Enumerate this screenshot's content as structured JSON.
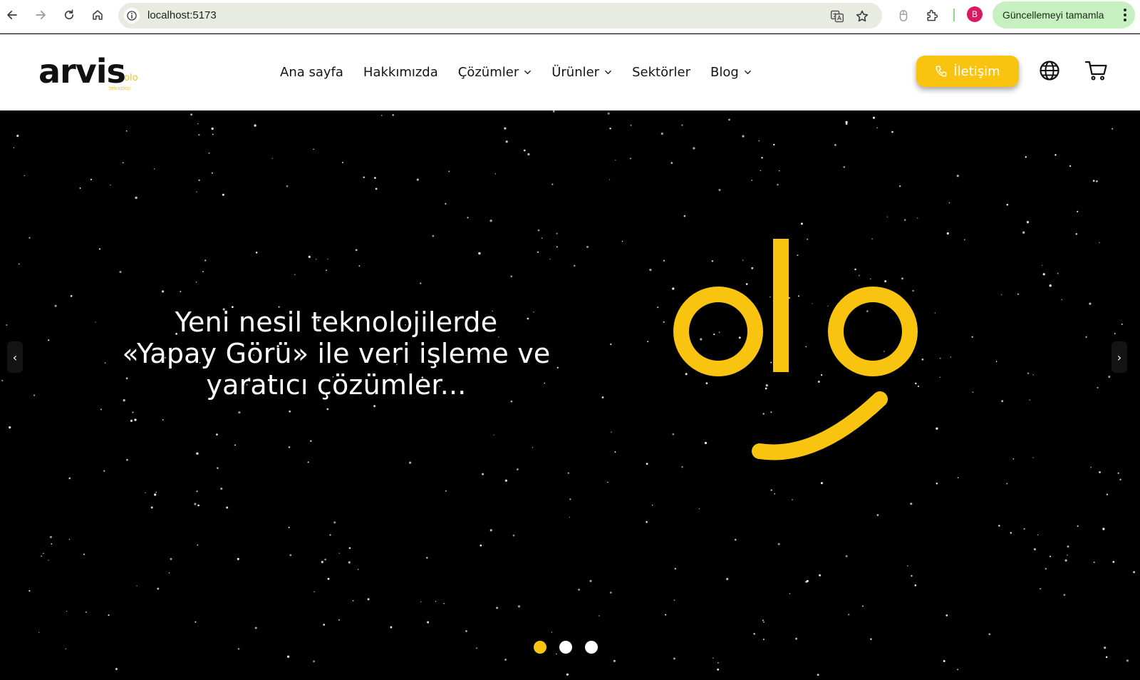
{
  "browser": {
    "url": "localhost:5173",
    "profile_initial": "B",
    "update_label": "Güncellemeyi tamamla",
    "accent_update_bg": "#c6f0bf"
  },
  "header": {
    "logo_text": "arvis",
    "logo_sub": "olo",
    "logo_tagline": "teknoloji",
    "nav": [
      {
        "label": "Ana sayfa",
        "dropdown": false
      },
      {
        "label": "Hakkımızda",
        "dropdown": false
      },
      {
        "label": "Çözümler",
        "dropdown": true
      },
      {
        "label": "Ürünler",
        "dropdown": true
      },
      {
        "label": "Sektörler",
        "dropdown": false
      },
      {
        "label": "Blog",
        "dropdown": true
      }
    ],
    "contact_label": "İletişim",
    "icons": [
      "phone-icon",
      "globe-icon",
      "cart-icon"
    ],
    "brand_color": "#f9c40f"
  },
  "hero": {
    "title_lines": [
      "Yeni nesil teknolojilerde",
      "«Yapay Görü» ile veri işleme ve",
      "yaratıcı çözümler..."
    ],
    "prev_label": "‹",
    "next_label": "›",
    "slides": 3,
    "active_slide": 1
  }
}
